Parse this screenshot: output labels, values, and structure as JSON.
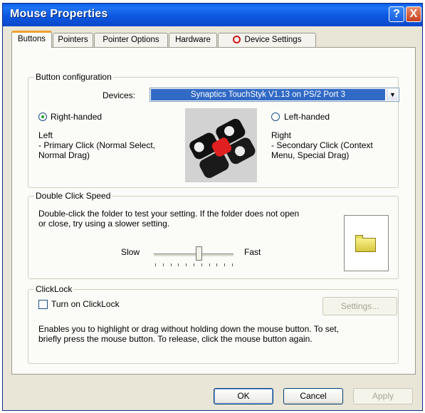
{
  "window": {
    "title": "Mouse Properties",
    "help_symbol": "?",
    "close_symbol": "X"
  },
  "tabs": [
    {
      "label": "Buttons"
    },
    {
      "label": "Pointers"
    },
    {
      "label": "Pointer Options"
    },
    {
      "label": "Hardware"
    },
    {
      "label": "Device Settings"
    }
  ],
  "button_configuration": {
    "group_label": "Button configuration",
    "devices_label": "Devices:",
    "devices_value": "Synaptics TouchStyk V1.13 on PS/2 Port 3",
    "right_handed_label": "Right-handed",
    "right_handed_checked": true,
    "left_handed_label": "Left-handed",
    "left_handed_checked": false,
    "left_title": "Left",
    "left_desc_1": " - Primary Click (Normal Select,",
    "left_desc_2": "Normal Drag)",
    "right_title": "Right",
    "right_desc_1": " - Secondary Click (Context",
    "right_desc_2": "Menu, Special Drag)"
  },
  "double_click": {
    "group_label": "Double Click Speed",
    "instructions_1": "Double-click the folder to test your setting.  If the folder does not open",
    "instructions_2": "or close, try using a slower setting.",
    "slow_label": "Slow",
    "fast_label": "Fast",
    "speed_fraction": 0.57
  },
  "clicklock": {
    "group_label": "ClickLock",
    "checkbox_label": "Turn on ClickLock",
    "checked": false,
    "settings_label": "Settings...",
    "desc_1": "Enables you to highlight or drag without holding down the mouse button.  To set,",
    "desc_2": "briefly press the mouse button.  To release, click the mouse button again."
  },
  "footer": {
    "ok_label": "OK",
    "cancel_label": "Cancel",
    "apply_label": "Apply"
  },
  "colors": {
    "titlebar": "#0b5ee8",
    "selected_device_bg": "#316ac5",
    "tab_highlight": "#f0a030"
  }
}
